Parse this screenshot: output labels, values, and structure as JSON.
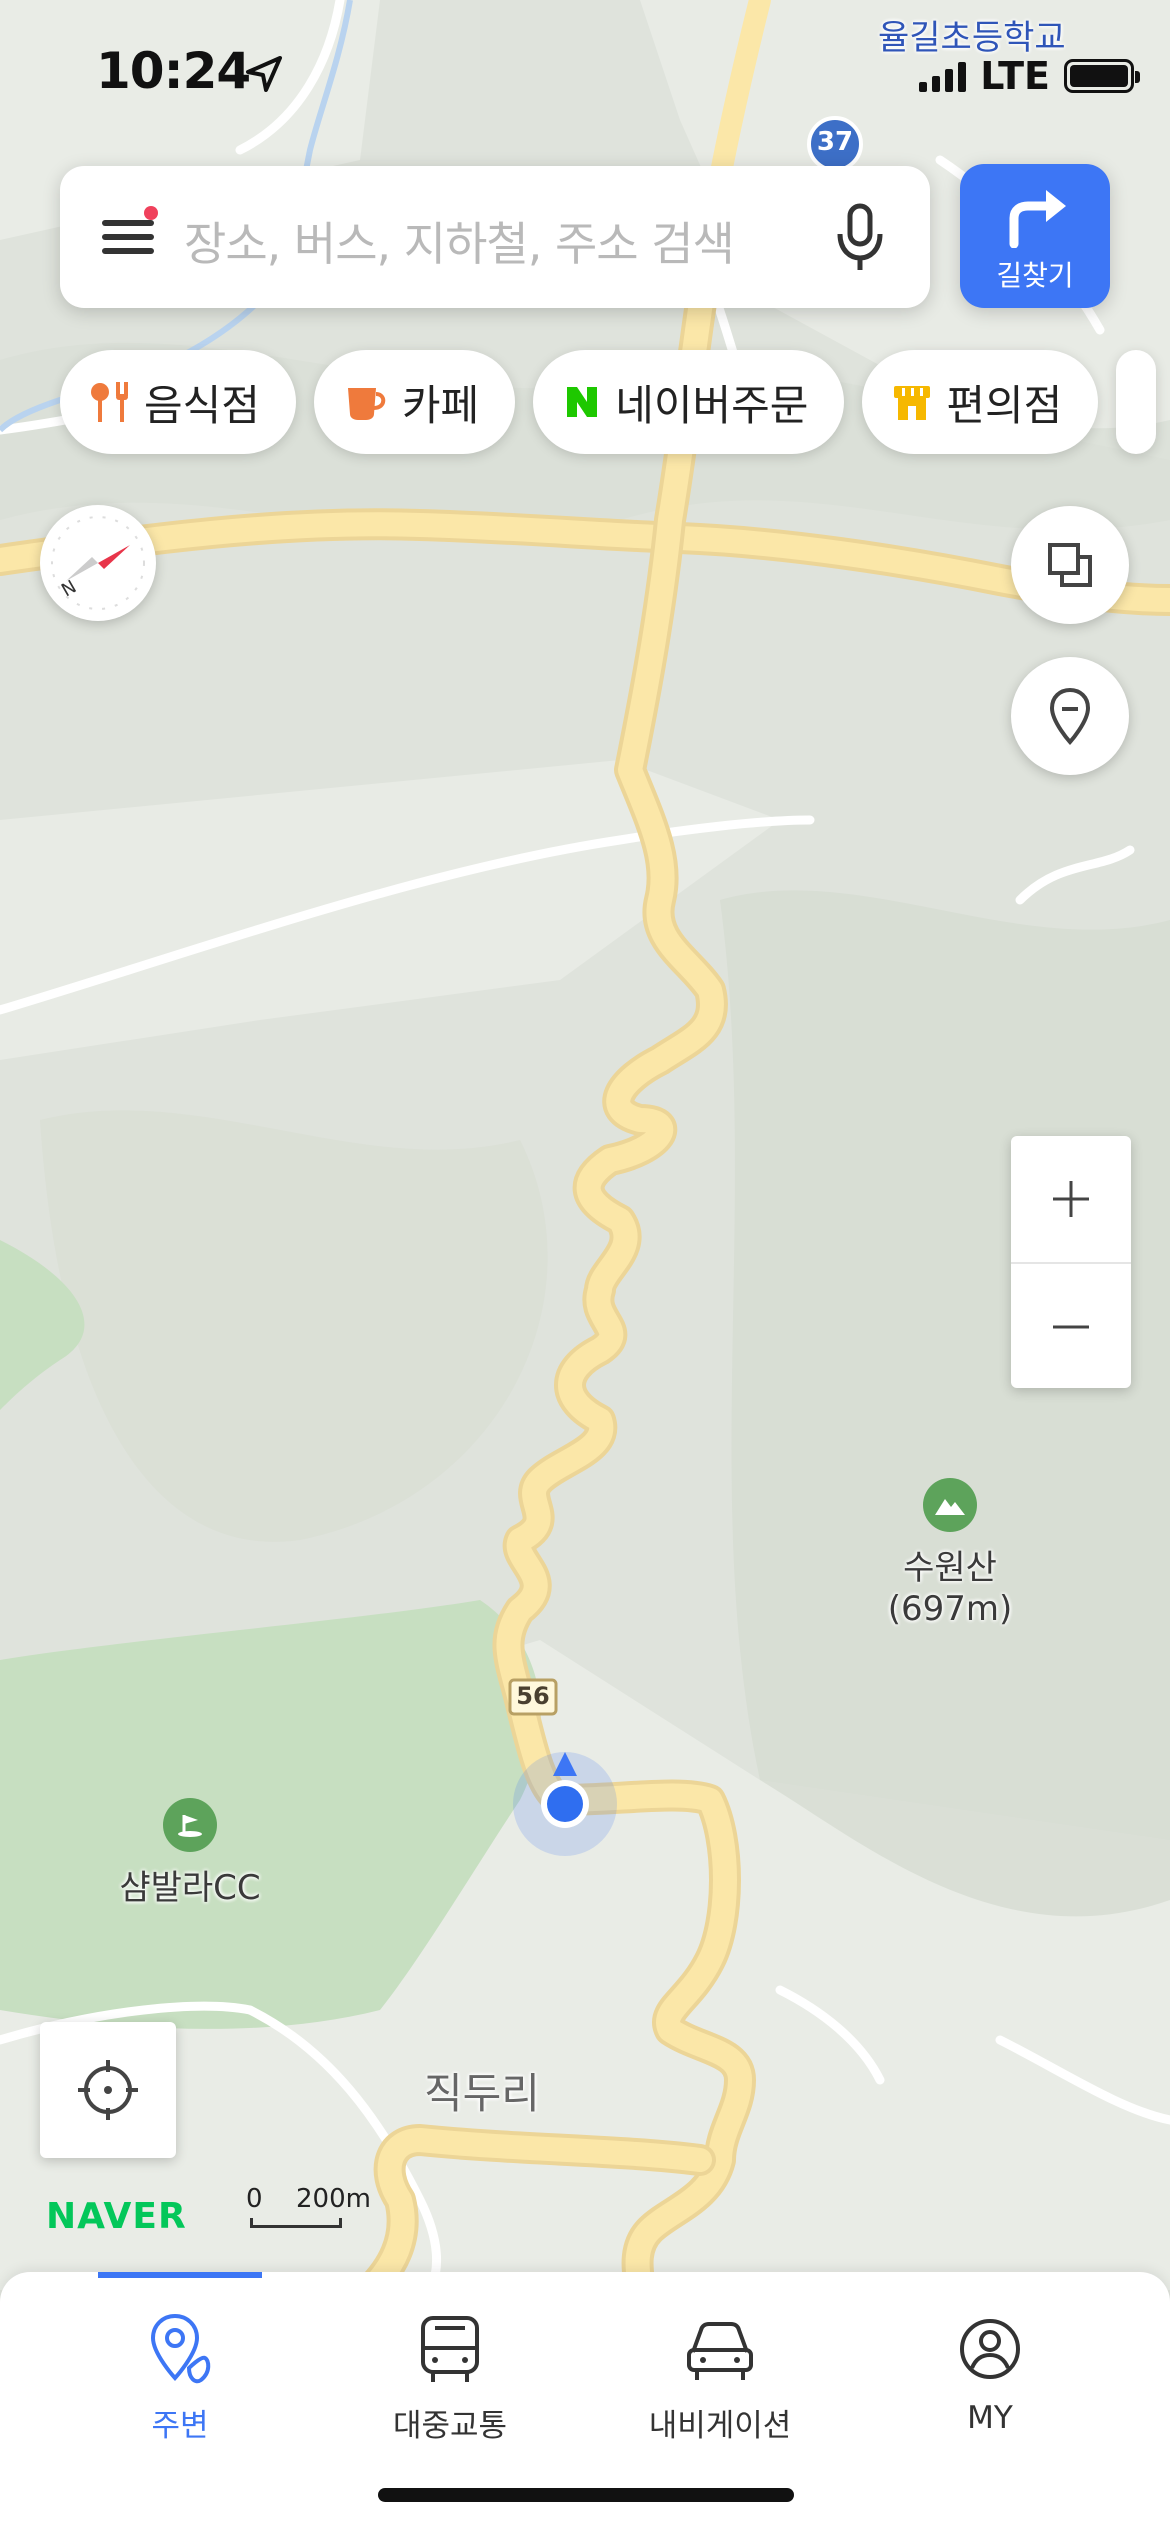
{
  "status_bar": {
    "time": "10:24",
    "network": "LTE"
  },
  "search": {
    "placeholder": "장소, 버스, 지하철, 주소 검색"
  },
  "route_button": {
    "label": "길찾기"
  },
  "chips": [
    {
      "label": "음식점",
      "icon": "fork-knife-icon"
    },
    {
      "label": "카페",
      "icon": "cup-icon"
    },
    {
      "label": "네이버주문",
      "icon": "naver-n-icon"
    },
    {
      "label": "편의점",
      "icon": "store-icon"
    }
  ],
  "map": {
    "labels": {
      "school": "율길초등학교",
      "route_37": "37",
      "route_56": "56",
      "mountain_name": "수원산",
      "mountain_height": "(697m)",
      "golf_club": "샴발라CC",
      "village": "직두리"
    },
    "brand": "NAVER",
    "scale": {
      "zero": "0",
      "distance": "200m"
    },
    "colors": {
      "road": "#fbe7a8",
      "route_accent": "#3d76f5",
      "forest": "#c7dfc1",
      "terrain": "#dfe3dc"
    }
  },
  "tabs": [
    {
      "label": "주변",
      "icon": "pin-icon",
      "active": true
    },
    {
      "label": "대중교통",
      "icon": "bus-icon",
      "active": false
    },
    {
      "label": "내비게이션",
      "icon": "car-icon",
      "active": false
    },
    {
      "label": "MY",
      "icon": "user-icon",
      "active": false
    }
  ]
}
